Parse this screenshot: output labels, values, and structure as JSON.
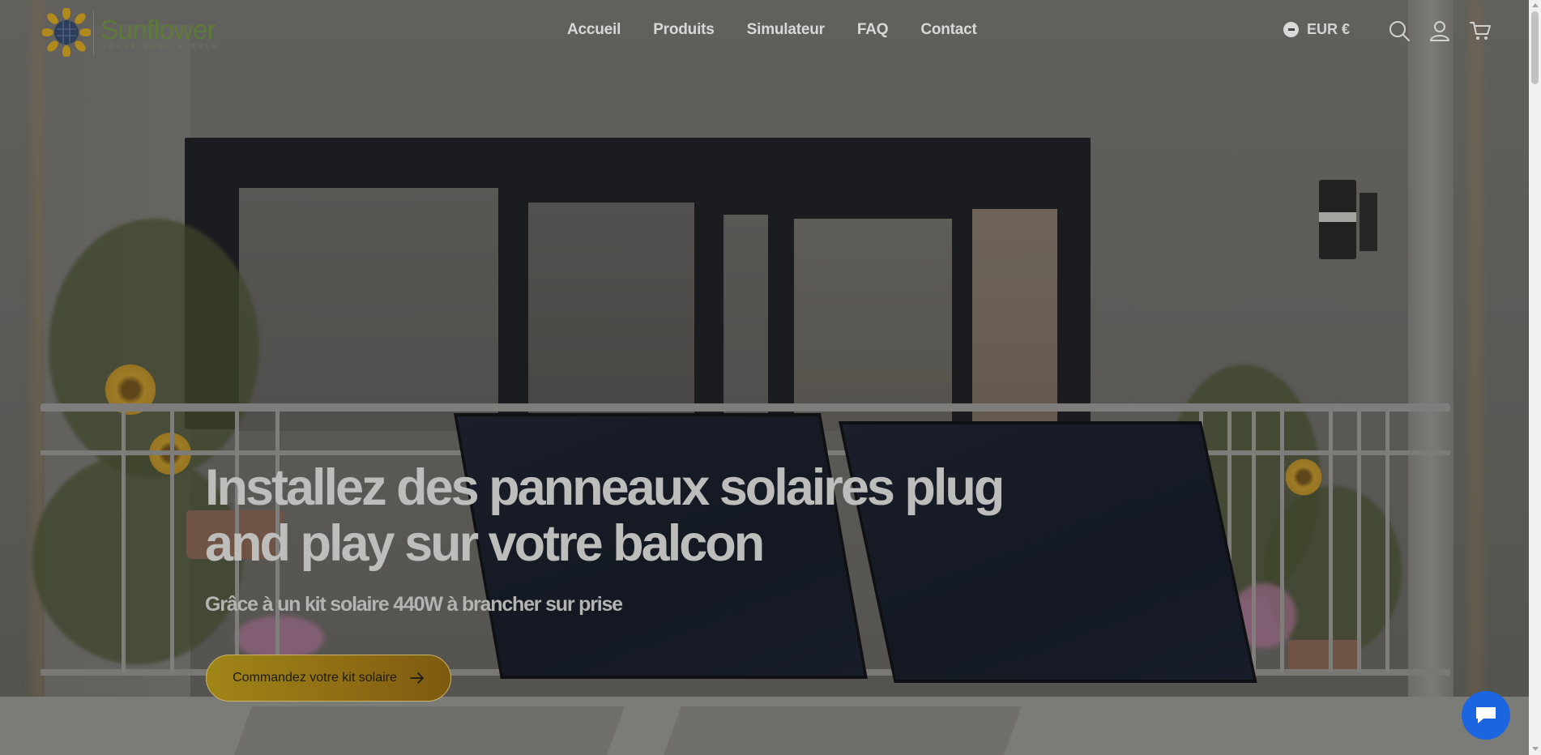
{
  "brand": {
    "name": "Sunflower",
    "tagline": "SOLAR MADE SIMPLE"
  },
  "nav": {
    "items": [
      {
        "label": "Accueil"
      },
      {
        "label": "Produits"
      },
      {
        "label": "Simulateur"
      },
      {
        "label": "FAQ"
      },
      {
        "label": "Contact"
      }
    ]
  },
  "header": {
    "currency_label": "EUR €",
    "icons": [
      "search-icon",
      "account-icon",
      "cart-icon"
    ]
  },
  "hero": {
    "title_line1": "Installez des panneaux solaires plug",
    "title_line2": "and play sur votre balcon",
    "subtitle": "Grâce à un kit solaire 440W à brancher sur prise",
    "cta_label": "Commandez votre kit solaire"
  },
  "chat": {
    "icon": "chat-bubble-icon"
  },
  "colors": {
    "brand_green": "#5d7a3a",
    "cta_gold": "#a08518",
    "chat_blue": "#1b66e0",
    "nav_text": "#d8d8d6"
  }
}
